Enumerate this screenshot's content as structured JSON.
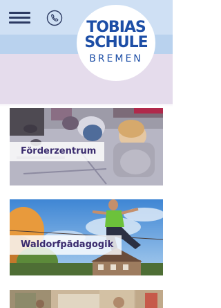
{
  "header": {
    "menu_icon": "hamburger-menu-icon",
    "phone_icon": "phone-icon",
    "logo": {
      "line1": "TOBIAS",
      "line2": "SCHULE",
      "line3": "BREMEN"
    },
    "colors": {
      "band_top": "#cfe0f4",
      "band_mid": "#b9d2ee",
      "band_low": "#e5dcec",
      "navy": "#2c3a62",
      "logo_blue": "#1d4ea6"
    }
  },
  "cards": [
    {
      "label": "Förderzentrum"
    },
    {
      "label": "Waldorfpädagogik"
    },
    {
      "label": ""
    }
  ],
  "colors": {
    "card_label_text": "#3a2b6e"
  }
}
